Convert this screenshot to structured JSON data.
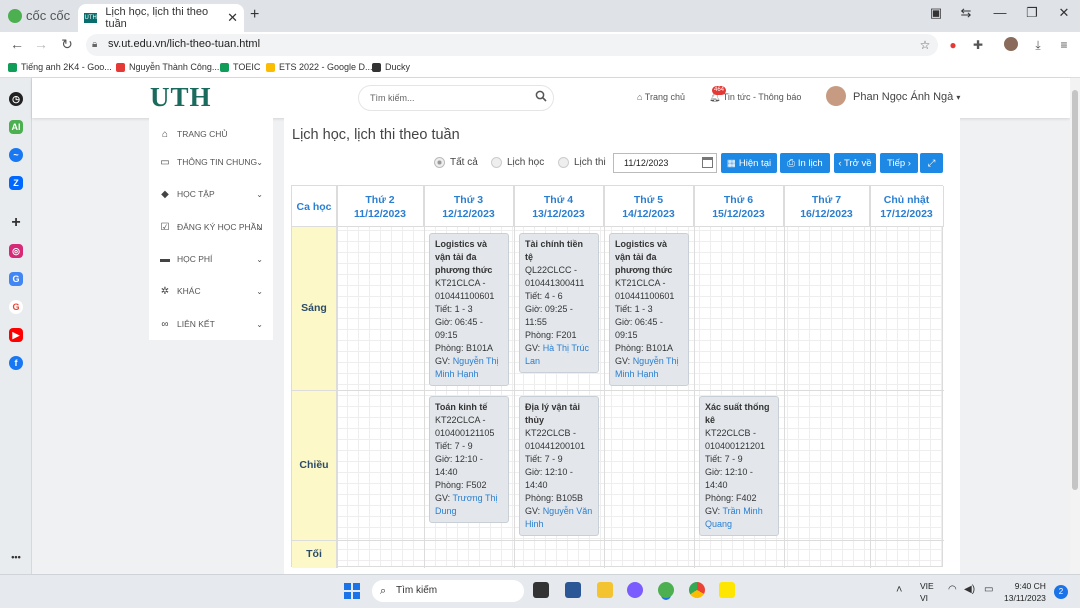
{
  "browser": {
    "name": "cốc cốc",
    "tab_title": "Lịch học, lịch thi theo tuần",
    "tab_favicon": "UTH",
    "url": "sv.ut.edu.vn/lich-theo-tuan.html",
    "bookmarks": [
      {
        "label": "Tiếng anh 2K4 - Goo...",
        "color": "#0f9d58"
      },
      {
        "label": "Nguyễn Thành Công...",
        "color": "#e53935"
      },
      {
        "label": "TOEIC",
        "color": "#0f9d58"
      },
      {
        "label": "ETS 2022 - Google D...",
        "color": "#fbbc04"
      },
      {
        "label": "Ducky",
        "color": "#333333"
      }
    ]
  },
  "header": {
    "logo": "UTH",
    "search_placeholder": "Tìm kiếm...",
    "home_label": "Trang chủ",
    "news_label": "Tin tức - Thông báo",
    "news_badge": "464",
    "user_name": "Phan Ngọc Ánh Ngà"
  },
  "menu": [
    {
      "label": "TRANG CHỦ",
      "icon": "home-icon",
      "glyph": "⌂",
      "chev": false
    },
    {
      "label": "THÔNG TIN CHUNG",
      "icon": "monitor-icon",
      "glyph": "▭",
      "chev": true
    },
    {
      "label": "HỌC TẬP",
      "icon": "graduation-cap-icon",
      "glyph": "◆",
      "chev": true
    },
    {
      "label": "ĐĂNG KÝ HỌC PHẦN",
      "icon": "checkbox-icon",
      "glyph": "☑",
      "chev": true
    },
    {
      "label": "HỌC PHÍ",
      "icon": "visa-card-icon",
      "glyph": "▬",
      "chev": true
    },
    {
      "label": "KHÁC",
      "icon": "gear-icon",
      "glyph": "✲",
      "chev": true
    },
    {
      "label": "LIÊN KẾT",
      "icon": "link-icon",
      "glyph": "∞",
      "chev": true
    }
  ],
  "main": {
    "title": "Lịch học, lịch thi theo tuần",
    "filters": [
      "Tất cả",
      "Lịch học",
      "Lịch thi"
    ],
    "selected_filter": "Tất cả",
    "date": "11/12/2023",
    "buttons": {
      "current": "Hiện tại",
      "print": "In lịch",
      "back": "‹ Trở về",
      "next": "Tiếp ›"
    }
  },
  "schedule": {
    "shift_header": "Ca học",
    "days": [
      {
        "name": "Thứ 2",
        "date": "11/12/2023"
      },
      {
        "name": "Thứ 3",
        "date": "12/12/2023"
      },
      {
        "name": "Thứ 4",
        "date": "13/12/2023"
      },
      {
        "name": "Thứ 5",
        "date": "14/12/2023"
      },
      {
        "name": "Thứ 6",
        "date": "15/12/2023"
      },
      {
        "name": "Thứ 7",
        "date": "16/12/2023"
      },
      {
        "name": "Chủ nhật",
        "date": "17/12/2023"
      }
    ],
    "shifts": [
      "Sáng",
      "Chiều",
      "Tối"
    ],
    "classes": [
      {
        "shift": 0,
        "day": 1,
        "title": "Logistics và vận tải đa phương thức",
        "code": "KT21CLCA - 010441100601",
        "period": "Tiết: 1 - 3",
        "time": "Giờ: 06:45 - 09:15",
        "room": "Phòng: B101A",
        "gv_label": "GV:",
        "teacher": "Nguyễn Thị Minh Hạnh"
      },
      {
        "shift": 0,
        "day": 2,
        "title": "Tài chính tiền tệ",
        "code": "QL22CLCC - 010441300411",
        "period": "Tiết: 4 - 6",
        "time": "Giờ: 09:25 - 11:55",
        "room": "Phòng: F201",
        "gv_label": "GV:",
        "teacher": "Hà Thị Trúc Lan"
      },
      {
        "shift": 0,
        "day": 3,
        "title": "Logistics và vận tải đa phương thức",
        "code": "KT21CLCA - 010441100601",
        "period": "Tiết: 1 - 3",
        "time": "Giờ: 06:45 - 09:15",
        "room": "Phòng: B101A",
        "gv_label": "GV:",
        "teacher": "Nguyễn Thị Minh Hạnh"
      },
      {
        "shift": 1,
        "day": 1,
        "title": "Toán kinh tế",
        "code": "KT22CLCA - 010400121105",
        "period": "Tiết: 7 - 9",
        "time": "Giờ: 12:10 - 14:40",
        "room": "Phòng: F502",
        "gv_label": "GV:",
        "teacher": "Trương Thị Dung"
      },
      {
        "shift": 1,
        "day": 2,
        "title": "Địa lý vận tải thủy",
        "code": "KT22CLCB - 010441200101",
        "period": "Tiết: 7 - 9",
        "time": "Giờ: 12:10 - 14:40",
        "room": "Phòng: B105B",
        "gv_label": "GV:",
        "teacher": "Nguyễn Văn Hinh"
      },
      {
        "shift": 1,
        "day": 4,
        "title": "Xác suất thống kê",
        "code": "KT22CLCB - 010400121201",
        "period": "Tiết: 7 - 9",
        "time": "Giờ: 12:10 - 14:40",
        "room": "Phòng: F402",
        "gv_label": "GV:",
        "teacher": "Trần Minh Quang"
      }
    ]
  },
  "taskbar": {
    "search_placeholder": "Tìm kiếm",
    "lang_line1": "VIE",
    "lang_line2": "VI",
    "time": "9:40 CH",
    "date": "13/11/2023",
    "notifications": "2"
  }
}
